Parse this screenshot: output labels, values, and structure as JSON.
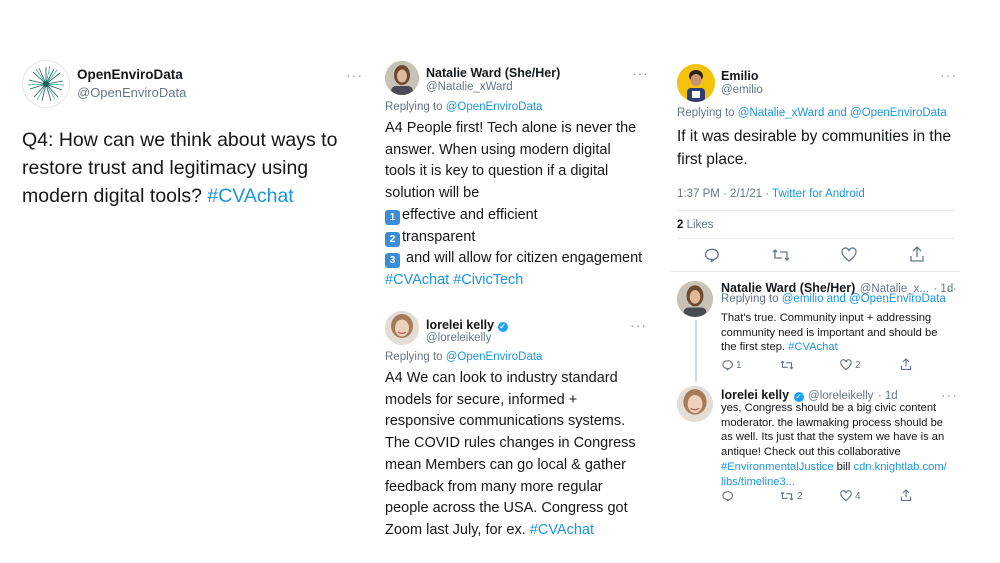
{
  "tweet1": {
    "name": "OpenEnviroData",
    "handle": "@OpenEnviroData",
    "more": "···",
    "text": "Q4: How can we think about ways to restore trust and legitimacy using modern digital tools?",
    "hashtag": "#CVAchat"
  },
  "tweet2": {
    "name": "Natalie Ward (She/Her)",
    "handle": "@Natalie_xWard",
    "more": "···",
    "replying_label": "Replying to",
    "replying_to": "@OpenEnviroData",
    "line1": "A4 People first! Tech alone is never the",
    "line2": "answer. When using modern digital",
    "line3": "tools it is key to question if a digital",
    "line4": "solution will be",
    "item1_key": "1",
    "item1": "effective and efficient",
    "item2_key": "2",
    "item2": "transparent",
    "item3_key": "3",
    "item3": " and will allow for citizen engagement",
    "hashtags": "#CVAchat #CivicTech"
  },
  "tweet3": {
    "name": "lorelei kelly",
    "handle": "@loreleikelly",
    "more": "···",
    "replying_label": "Replying to",
    "replying_to": "@OpenEnviroData",
    "lines": [
      "A4 We can look to industry standard",
      "models for secure, informed +",
      "responsive communications systems.",
      "The COVID rules changes in Congress",
      "mean Members can go local & gather",
      "feedback from many more regular",
      "people across the USA. Congress got"
    ],
    "last_line": "Zoom last July, for ex.",
    "hashtag": "#CVAchat"
  },
  "tweet4": {
    "name": "Emilio",
    "handle": "@emilio",
    "more": "···",
    "replying_label": "Replying to",
    "replying_to": "@Natalie_xWard and @OpenEnviroData",
    "line1": "If it was desirable by communities in the",
    "line2": "first place.",
    "time": "1:37 PM · 2/1/21 ·",
    "source": "Twitter for Android",
    "likes_count": "2",
    "likes_label": "Likes"
  },
  "reply1": {
    "name": "Natalie Ward (She/Her)",
    "handle": "@Natalie_x...",
    "age": "· 1d",
    "more": "···",
    "replying_label": "Replying to",
    "replying_to": "@emilio and @OpenEnviroData",
    "line1": "That's true. Community input + addressing",
    "line2": "community need is important and should be",
    "line3": "the first step.",
    "hashtag": "#CVAchat",
    "reply_count": "1",
    "like_count": "2"
  },
  "reply2": {
    "name": "lorelei kelly",
    "handle": "@loreleikelly",
    "age": "· 1d",
    "more": "···",
    "line1": "yes, Congress should be a big civic content",
    "line2": "moderator. the lawmaking process should be",
    "line3": "as well.  Its just that the system we have is an",
    "line4": "antique!  Check out this collaborative",
    "hashtag": "#EnvironmentalJustice",
    "bill": " bill ",
    "link1": "cdn.knightlab.com/",
    "link2": "libs/timeline3...",
    "retweet_count": "2",
    "like_count": "4"
  }
}
